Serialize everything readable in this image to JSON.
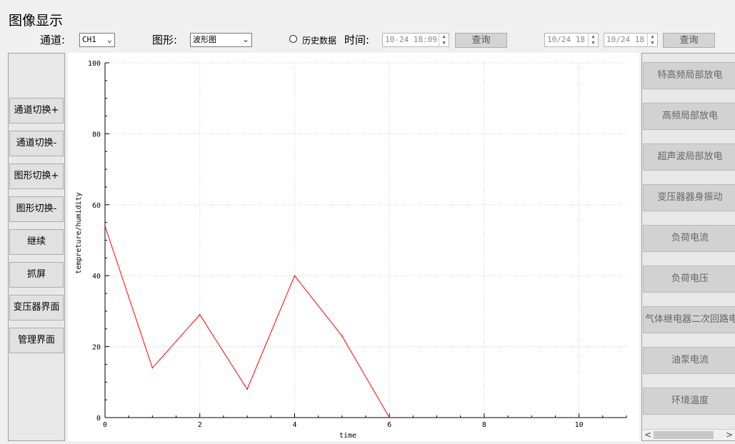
{
  "window": {
    "title": "图像显示"
  },
  "toolbar": {
    "channel_label": "通道:",
    "channel_value": "CH1",
    "shape_label": "图形:",
    "shape_value": "波形图",
    "history_label": "历史数据",
    "time_label": "时间:",
    "time_value": "10-24 18:09",
    "query_label": "查询",
    "range_start": "10/24 18",
    "range_end": "10/24 18",
    "query2_label": "查询"
  },
  "left_buttons": [
    "通道切换+",
    "通道切换-",
    "图形切换+",
    "图形切换-",
    "继续",
    "抓屏",
    "变压器界面",
    "管理界面"
  ],
  "right_buttons": [
    "特高频局部放电",
    "高频局部放电",
    "超声波局部放电",
    "变压器器身振动",
    "负荷电流",
    "负荷电压",
    "气体继电器二次回路电流",
    "油泵电流",
    "环境温度"
  ],
  "chart_data": {
    "type": "line",
    "xlabel": "time",
    "ylabel": "tempreture/humidity",
    "xlim": [
      0,
      11
    ],
    "ylim": [
      0,
      100
    ],
    "x_ticks": [
      "0",
      "2",
      "4",
      "6",
      "8",
      "10"
    ],
    "y_ticks": [
      "0",
      "20",
      "40",
      "60",
      "80",
      "100"
    ],
    "grid": true,
    "series": [
      {
        "color": "#ff0000",
        "x": [
          0,
          1,
          2,
          3,
          4,
          5,
          6
        ],
        "y": [
          54,
          14,
          29,
          8,
          40,
          23,
          0
        ]
      }
    ]
  }
}
